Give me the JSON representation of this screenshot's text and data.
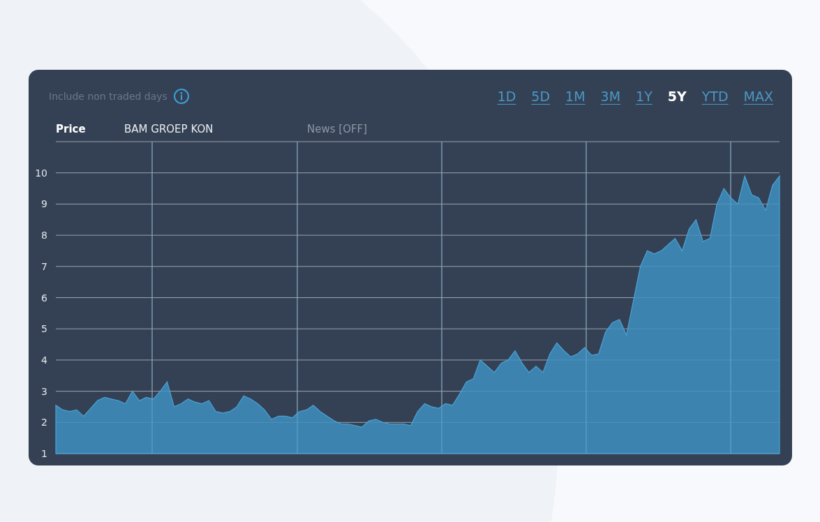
{
  "options": {
    "label": "Include non traded days"
  },
  "ranges": [
    {
      "label": "1D",
      "selected": false
    },
    {
      "label": "5D",
      "selected": false
    },
    {
      "label": "1M",
      "selected": false
    },
    {
      "label": "3M",
      "selected": false
    },
    {
      "label": "1Y",
      "selected": false
    },
    {
      "label": "5Y",
      "selected": true
    },
    {
      "label": "YTD",
      "selected": false
    },
    {
      "label": "MAX",
      "selected": false
    }
  ],
  "legend": {
    "series_label": "Price",
    "news": "News [OFF]"
  },
  "chart": {
    "chart_data": {
      "type": "area",
      "grid": true,
      "ylim": [
        1,
        11
      ],
      "yticks": [
        1,
        2,
        3,
        4,
        5,
        6,
        7,
        8,
        9,
        10
      ],
      "series": [
        {
          "name": "BAM GROEP KON",
          "color": "#3f8fbf",
          "values": [
            2.55,
            2.4,
            2.35,
            2.4,
            2.2,
            2.45,
            2.7,
            2.8,
            2.75,
            2.7,
            2.6,
            3.0,
            2.7,
            2.8,
            2.75,
            3.0,
            3.3,
            2.5,
            2.6,
            2.75,
            2.65,
            2.6,
            2.7,
            2.35,
            2.3,
            2.35,
            2.5,
            2.85,
            2.75,
            2.6,
            2.4,
            2.1,
            2.2,
            2.2,
            2.15,
            2.35,
            2.4,
            2.55,
            2.35,
            2.2,
            2.05,
            1.95,
            1.95,
            1.9,
            1.85,
            2.05,
            2.1,
            2.0,
            1.95,
            1.95,
            1.95,
            1.9,
            2.35,
            2.6,
            2.5,
            2.45,
            2.6,
            2.55,
            2.9,
            3.3,
            3.4,
            4.0,
            3.8,
            3.6,
            3.9,
            4.0,
            4.3,
            3.9,
            3.6,
            3.8,
            3.6,
            4.2,
            4.55,
            4.3,
            4.1,
            4.2,
            4.4,
            4.15,
            4.2,
            4.9,
            5.2,
            5.3,
            4.8,
            5.9,
            7.0,
            7.5,
            7.4,
            7.5,
            7.7,
            7.9,
            7.5,
            8.2,
            8.5,
            7.8,
            7.9,
            9.0,
            9.5,
            9.2,
            9.0,
            9.9,
            9.3,
            9.2,
            8.8,
            9.6,
            9.9
          ]
        }
      ]
    }
  }
}
